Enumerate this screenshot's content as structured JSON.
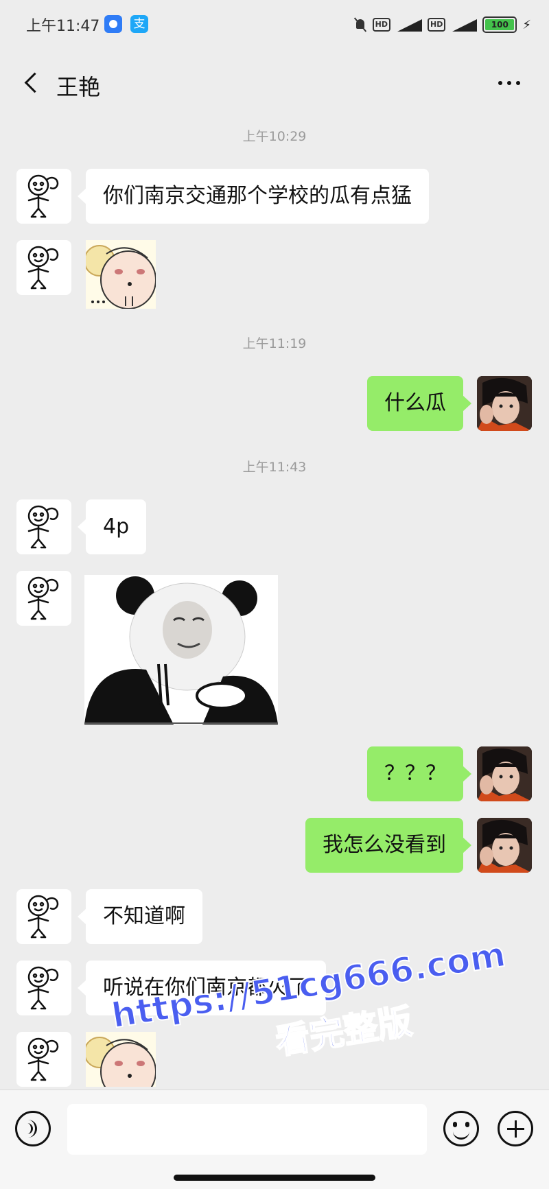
{
  "status_bar": {
    "time": "上午11:47",
    "battery": "100",
    "badges": [
      "HD",
      "HD"
    ],
    "icons": [
      "qq-browser-icon",
      "alipay-icon",
      "mute-icon",
      "signal-4g-icon",
      "signal-icon",
      "battery-icon",
      "charging-icon"
    ]
  },
  "nav": {
    "title": "王艳"
  },
  "messages": {
    "ts1": "上午10:29",
    "m1": "你们南京交通那个学校的瓜有点猛",
    "ts2": "上午11:19",
    "m3": "什么瓜",
    "ts3": "上午11:43",
    "m4": "4p",
    "m6": "？？？",
    "m7": "我怎么没看到",
    "m8": "不知道啊",
    "m9": "听说在你们南京都火了"
  },
  "stickers": [
    "sheep-face-sticker",
    "panda-meme-sticker",
    "sheep-face-sticker"
  ],
  "input": {
    "placeholder": ""
  },
  "watermark": {
    "url": "https://51cg666.com",
    "cta": "看完整版"
  },
  "colors": {
    "background": "#ededed",
    "sent_bubble": "#95ec69",
    "received_bubble": "#ffffff",
    "watermark": "#4a5ef0"
  }
}
